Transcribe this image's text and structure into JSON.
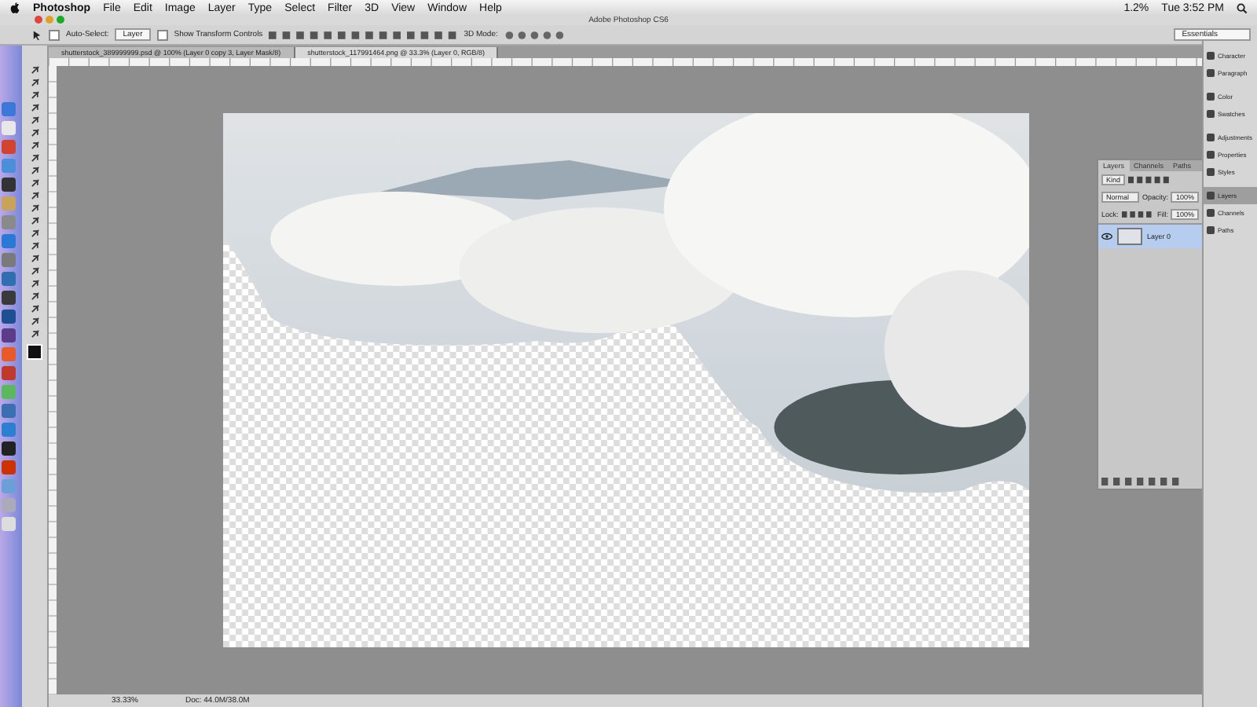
{
  "menu_bar": {
    "app": "Photoshop",
    "items": [
      "File",
      "Edit",
      "Image",
      "Layer",
      "Type",
      "Select",
      "Filter",
      "3D",
      "View",
      "Window",
      "Help"
    ],
    "battery": "1.2%",
    "clock": "Tue 3:52 PM"
  },
  "window": {
    "title": "Adobe Photoshop CS6"
  },
  "options_bar": {
    "auto_select": {
      "label": "Auto-Select:",
      "checked": false
    },
    "target": "Layer",
    "transform": {
      "label": "Show Transform Controls",
      "checked": false
    },
    "mode": "3D Mode:",
    "workspace": "Essentials"
  },
  "doc_tabs": [
    {
      "label": "shutterstock_389999999.psd @ 100% (Layer 0 copy 3, Layer Mask/8)",
      "selected": false
    },
    {
      "label": "shutterstock_117991464.png @ 33.3% (Layer 0, RGB/8)",
      "selected": true
    }
  ],
  "right_dock": [
    {
      "label": "Character",
      "selected": false
    },
    {
      "label": "Paragraph",
      "selected": false
    },
    {
      "label": "Color",
      "selected": false
    },
    {
      "label": "Swatches",
      "selected": false
    },
    {
      "label": "Adjustments",
      "selected": false
    },
    {
      "label": "Properties",
      "selected": false
    },
    {
      "label": "Styles",
      "selected": false
    },
    {
      "label": "Layers",
      "selected": true
    },
    {
      "label": "Channels",
      "selected": false
    },
    {
      "label": "Paths",
      "selected": false
    }
  ],
  "layers_panel": {
    "tabs": [
      {
        "label": "Layers",
        "selected": true
      },
      {
        "label": "Channels",
        "selected": false
      },
      {
        "label": "Paths",
        "selected": false
      }
    ],
    "filter": "Kind",
    "blend": "Normal",
    "opacity_label": "Opacity:",
    "opacity": "100%",
    "lock_label": "Lock:",
    "fill_label": "Fill:",
    "fill": "100%",
    "layers": [
      {
        "name": "Layer 0",
        "visible": true,
        "selected": true
      }
    ]
  },
  "status_bar": {
    "zoom": "33.33%",
    "doc": "Doc: 44.0M/38.0M"
  }
}
